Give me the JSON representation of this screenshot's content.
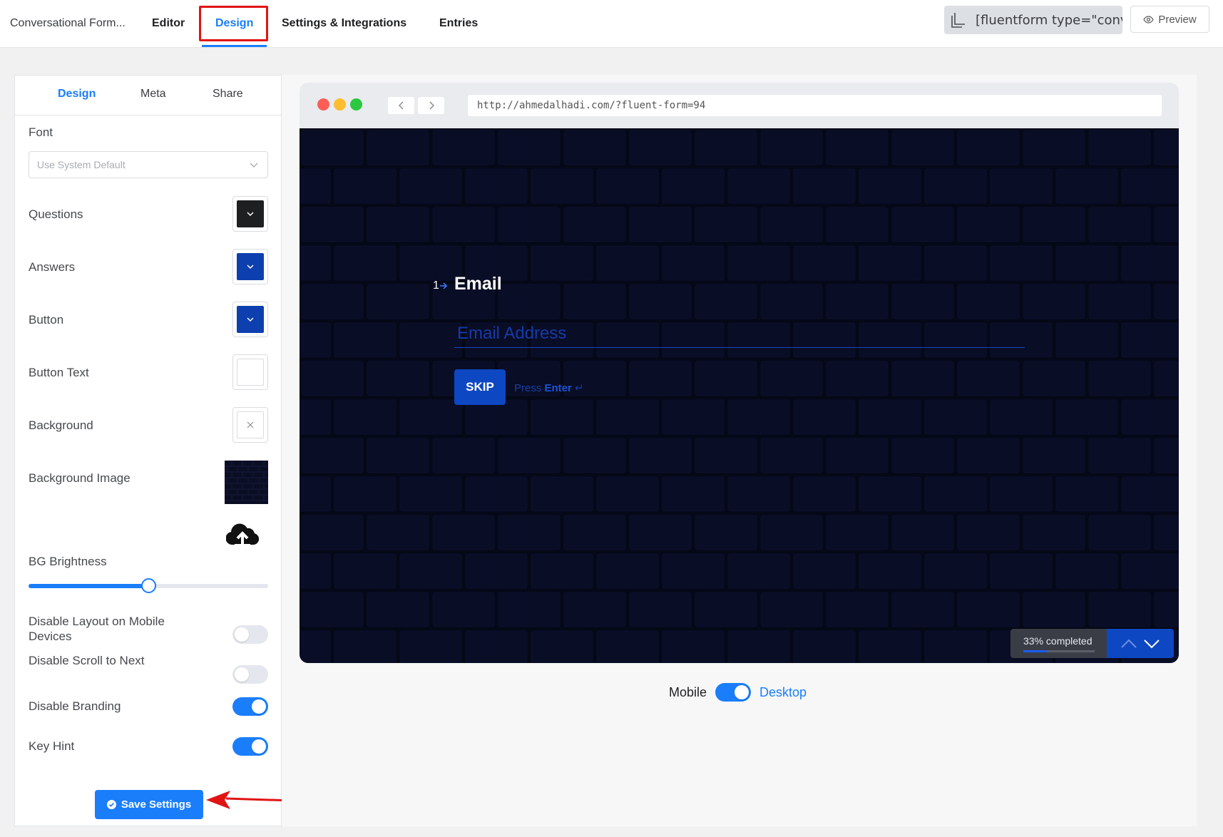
{
  "topbar": {
    "form_title": "Conversational Form...",
    "tabs": [
      {
        "label": "Editor"
      },
      {
        "label": "Design"
      },
      {
        "label": "Settings & Integrations"
      },
      {
        "label": "Entries"
      }
    ],
    "active_tab": "Design",
    "shortcode": "[fluentform type=\"convers",
    "preview_label": "Preview"
  },
  "panel": {
    "tabs": [
      {
        "label": "Design"
      },
      {
        "label": "Meta"
      },
      {
        "label": "Share"
      }
    ],
    "font_label": "Font",
    "font_placeholder": "Use System Default",
    "colors": [
      {
        "label": "Questions",
        "value": "#1e1f21"
      },
      {
        "label": "Answers",
        "value": "#0e3fae"
      },
      {
        "label": "Button",
        "value": "#0e3fae"
      },
      {
        "label": "Button Text",
        "value": "#ffffff"
      },
      {
        "label": "Background",
        "value": "none"
      }
    ],
    "bg_image_label": "Background Image",
    "bg_brightness_label": "BG Brightness",
    "bg_brightness_value": 0.5,
    "toggles": [
      {
        "label": "Disable Layout on Mobile Devices",
        "on": false
      },
      {
        "label": "Disable Scroll to Next",
        "on": false
      },
      {
        "label": "Disable Branding",
        "on": true
      },
      {
        "label": "Key Hint",
        "on": true
      }
    ],
    "save_label": "Save Settings"
  },
  "preview": {
    "url": "http://ahmedalhadi.com/?fluent-form=94",
    "question_number": "1",
    "question_title": "Email",
    "email_placeholder": "Email Address",
    "skip_label": "SKIP",
    "press_label": "Press",
    "enter_label": "Enter",
    "progress_text": "33% completed",
    "progress_value": 0.33,
    "mobile_label": "Mobile",
    "desktop_label": "Desktop",
    "desktop_on": true
  },
  "colors": {
    "accent": "#1a7efb",
    "form_bg": "#070a1a",
    "form_accent": "#0e47c2",
    "highlight": "#e01414"
  }
}
